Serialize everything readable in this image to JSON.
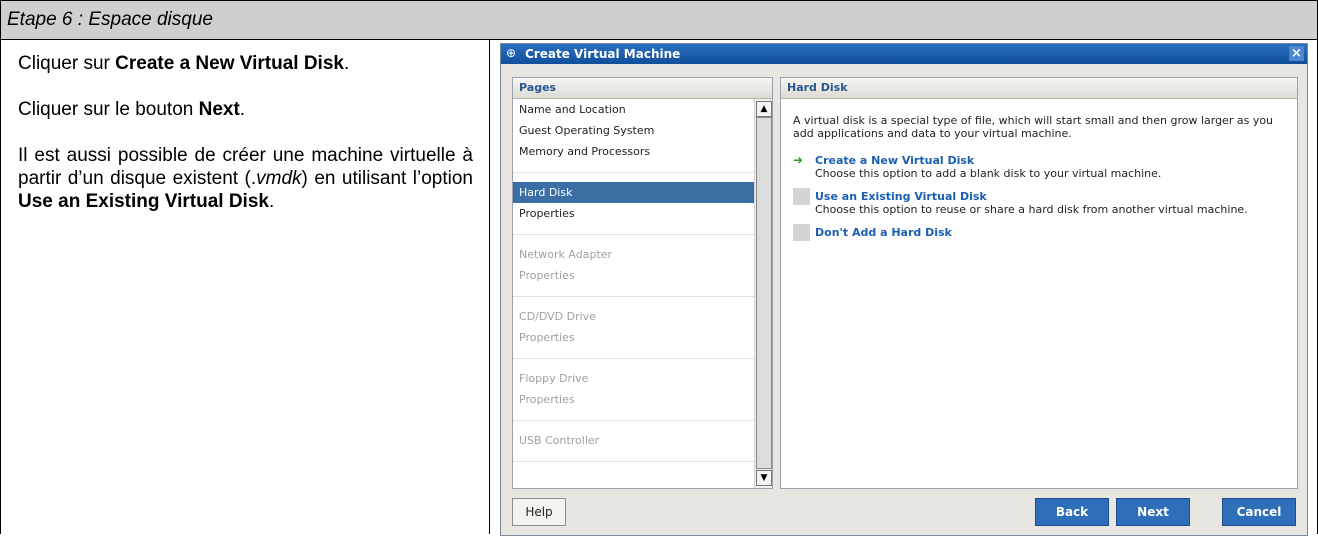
{
  "step_title": "Etape 6 : Espace disque",
  "instructions": {
    "p1_prefix": "Cliquer sur ",
    "p1_bold": "Create a New Virtual Disk",
    "p1_suffix": ".",
    "p2_prefix": "Cliquer sur le bouton ",
    "p2_bold": "Next",
    "p2_suffix": ".",
    "p3_prefix": "Il est aussi possible de créer une machine virtuelle à partir d’un disque existent (.",
    "p3_italic": "vmdk",
    "p3_middle": ") en utilisant l’option ",
    "p3_bold": "Use an Existing Virtual Disk",
    "p3_suffix": "."
  },
  "dialog": {
    "title": "Create Virtual Machine",
    "close_label": "×",
    "pages_header": "Pages",
    "pages": [
      {
        "label": "Name and Location",
        "state": "normal"
      },
      {
        "label": "Guest Operating System",
        "state": "normal"
      },
      {
        "label": "Memory and Processors",
        "state": "normal"
      },
      {
        "label": "Hard Disk",
        "state": "selected"
      },
      {
        "label": "Properties",
        "state": "normal"
      },
      {
        "label": "Network Adapter",
        "state": "disabled"
      },
      {
        "label": "Properties",
        "state": "disabled"
      },
      {
        "label": "CD/DVD Drive",
        "state": "disabled"
      },
      {
        "label": "Properties",
        "state": "disabled"
      },
      {
        "label": "Floppy Drive",
        "state": "disabled"
      },
      {
        "label": "Properties",
        "state": "disabled"
      },
      {
        "label": "USB Controller",
        "state": "disabled"
      }
    ],
    "hard_disk_header": "Hard Disk",
    "intro": "A virtual disk is a special type of file, which will start small and then grow larger as you add applications and data to your virtual machine.",
    "options": [
      {
        "title": "Create a New Virtual Disk",
        "desc": "Choose this option to add a blank disk to your virtual machine.",
        "marker": "arrow-right-icon"
      },
      {
        "title": "Use an Existing Virtual Disk",
        "desc": "Choose this option to reuse or share a hard disk from another virtual machine.",
        "marker": "gray-box-icon"
      },
      {
        "title": "Don't Add a Hard Disk",
        "desc": "",
        "marker": "gray-box-icon"
      }
    ],
    "buttons": {
      "help": "Help",
      "back": "Back",
      "next": "Next",
      "cancel": "Cancel"
    },
    "colors": {
      "title_bar": "#1a5aa8",
      "link": "#1a5fb4",
      "selected": "#3a6ea5",
      "button": "#2f6fba"
    }
  }
}
